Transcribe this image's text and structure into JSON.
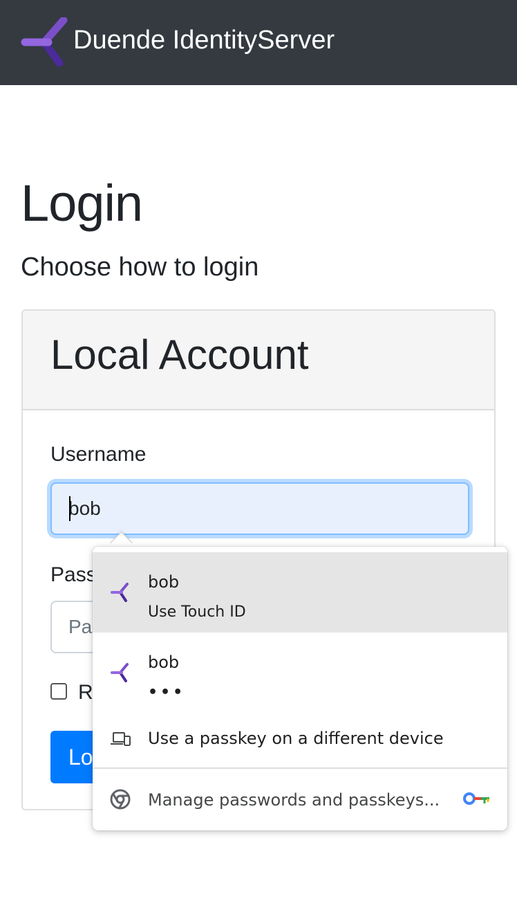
{
  "header": {
    "brand_name": "Duende IdentityServer",
    "logo_icon": "duende-logo-icon",
    "background": "#343a40"
  },
  "page": {
    "title": "Login",
    "subtitle": "Choose how to login"
  },
  "card": {
    "title": "Local Account",
    "username": {
      "label": "Username",
      "value": "bob"
    },
    "password": {
      "label_visible": "Pass",
      "placeholder_visible": "Pa"
    },
    "remember": {
      "label_visible": "R",
      "checked": false
    },
    "login_button_visible": "Lo",
    "accent_color": "#007bff"
  },
  "autofill_popup": {
    "items": [
      {
        "icon": "duende-passkey-icon",
        "primary": "bob",
        "secondary": "Use Touch ID",
        "highlighted": true
      },
      {
        "icon": "duende-passkey-icon",
        "primary": "bob",
        "secondary": "•••"
      },
      {
        "icon": "devices-icon",
        "primary": "Use a passkey on a different device"
      }
    ],
    "footer": {
      "icon": "chrome-icon",
      "label": "Manage passwords and passkeys...",
      "trailing_icon": "google-password-key-icon"
    }
  }
}
